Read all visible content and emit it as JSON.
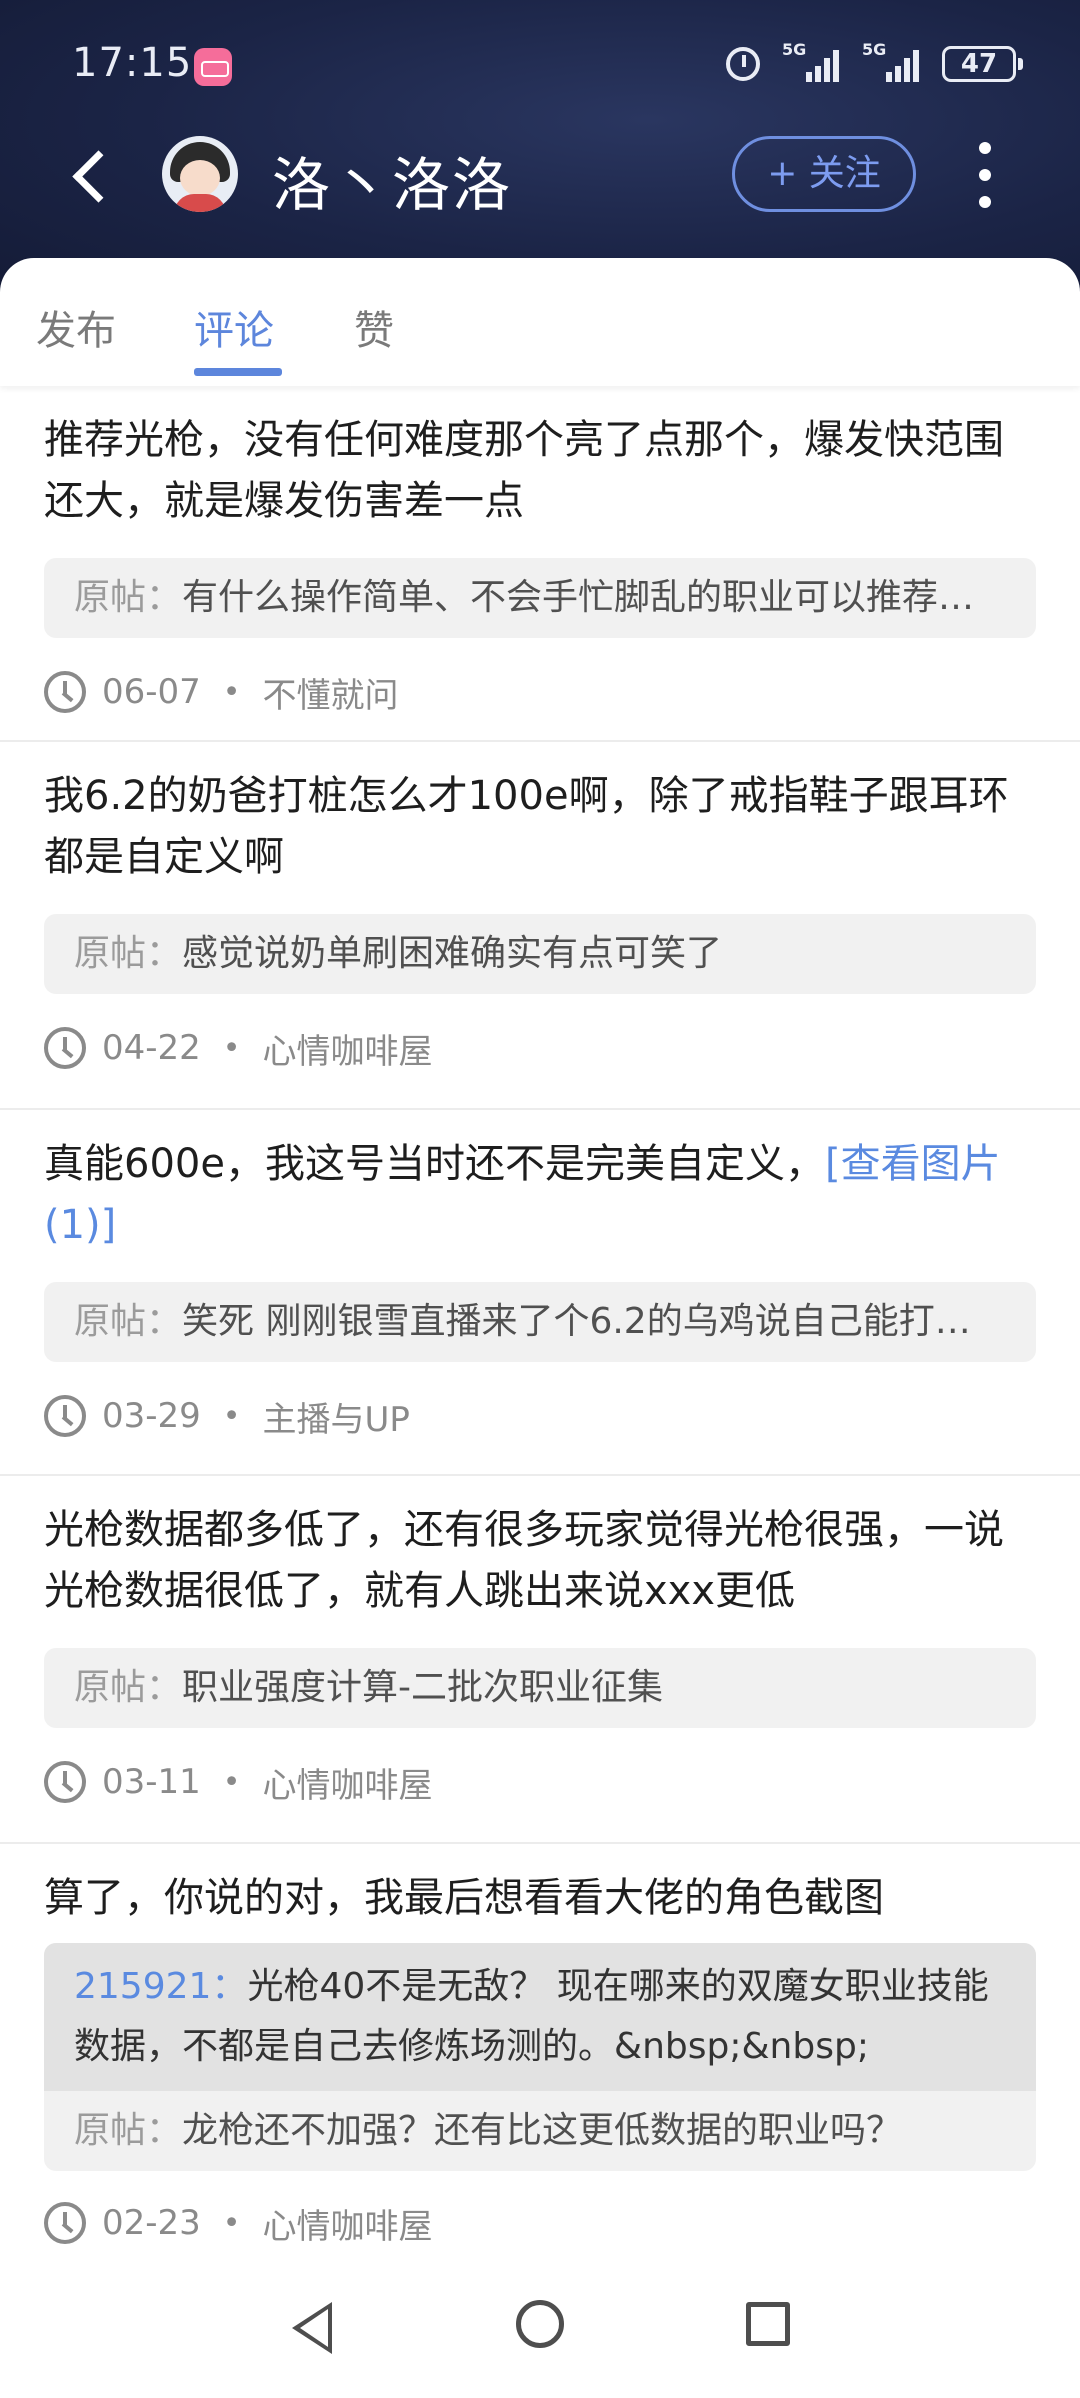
{
  "status_bar": {
    "time": "17:15",
    "signal_1_label": "5G",
    "signal_2_label": "5G",
    "battery": "47"
  },
  "header": {
    "user_name": "洛丶洛洛",
    "follow_label": "+ 关注"
  },
  "tabs": [
    {
      "label": "发布",
      "active": false
    },
    {
      "label": "评论",
      "active": true
    },
    {
      "label": "赞",
      "active": false
    }
  ],
  "quote_prefix": "原帖：",
  "items": [
    {
      "text": "推荐光枪，没有任何难度那个亮了点那个，爆发快范围还大，就是爆发伤害差一点",
      "original_post": "有什么操作简单、不会手忙脚乱的职业可以推荐…",
      "date": "06-07",
      "board": "不懂就问"
    },
    {
      "text": "我6.2的奶爸打桩怎么才100e啊，除了戒指鞋子跟耳环都是自定义啊",
      "original_post": "感觉说奶单刷困难确实有点可笑了",
      "date": "04-22",
      "board": "心情咖啡屋"
    },
    {
      "text": "真能600e，我这号当时还不是完美自定义，",
      "link": "[查看图片(1)]",
      "original_post": "笑死 刚刚银雪直播来了个6.2的乌鸡说自己能打…",
      "date": "03-29",
      "board": "主播与UP"
    },
    {
      "text": "光枪数据都多低了，还有很多玩家觉得光枪很强，一说光枪数据很低了，就有人跳出来说xxx更低",
      "original_post": "职业强度计算-二批次职业征集",
      "date": "03-11",
      "board": "心情咖啡屋"
    },
    {
      "text": "算了，你说的对，我最后想看看大佬的角色截图",
      "reply_user": "215921：",
      "reply_text": "光枪40不是无敌？ 现在哪来的双魔女职业技能数据，不都是自己去修炼场测的。&nbsp;&nbsp;",
      "original_post": "龙枪还不加强？还有比这更低数据的职业吗？",
      "date": "02-23",
      "board": "心情咖啡屋"
    }
  ],
  "meta_separator": "•"
}
